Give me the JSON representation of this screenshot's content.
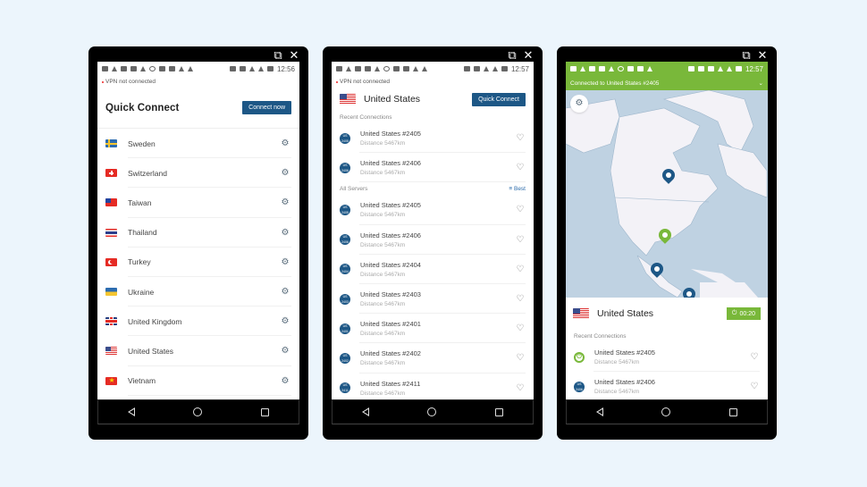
{
  "window_controls": {
    "popout_icon": "popout-icon",
    "close_icon": "close-icon"
  },
  "phone1": {
    "status_time": "12:56",
    "vpn_status": "VPN not connected",
    "title": "Quick Connect",
    "connect_button": "Connect now",
    "countries": [
      {
        "name": "Sweden",
        "flag": "se"
      },
      {
        "name": "Switzerland",
        "flag": "ch"
      },
      {
        "name": "Taiwan",
        "flag": "tw"
      },
      {
        "name": "Thailand",
        "flag": "th"
      },
      {
        "name": "Turkey",
        "flag": "tr"
      },
      {
        "name": "Ukraine",
        "flag": "ua"
      },
      {
        "name": "United Kingdom",
        "flag": "gb"
      },
      {
        "name": "United States",
        "flag": "us"
      },
      {
        "name": "Vietnam",
        "flag": "vn"
      }
    ]
  },
  "phone2": {
    "status_time": "12:57",
    "vpn_status": "VPN not connected",
    "title": "United States",
    "quick_connect_button": "Quick Connect",
    "recent_label": "Recent Connections",
    "recent": [
      {
        "name": "United States #2405",
        "distance": "Distance 5467km",
        "badge": "US 2405"
      },
      {
        "name": "United States #2406",
        "distance": "Distance 5467km",
        "badge": "US 2406"
      }
    ],
    "all_label": "All Servers",
    "sort_label": "Best",
    "servers": [
      {
        "name": "United States #2405",
        "distance": "Distance 5467km",
        "badge": "US 2405"
      },
      {
        "name": "United States #2406",
        "distance": "Distance 5467km",
        "badge": "US 2406"
      },
      {
        "name": "United States #2404",
        "distance": "Distance 5467km",
        "badge": "US 2404"
      },
      {
        "name": "United States #2403",
        "distance": "Distance 5467km",
        "badge": "US 2403"
      },
      {
        "name": "United States #2401",
        "distance": "Distance 5467km",
        "badge": "US 2401"
      },
      {
        "name": "United States #2402",
        "distance": "Distance 5467km",
        "badge": "US 2402"
      },
      {
        "name": "United States #2411",
        "distance": "Distance 5467km",
        "badge": "US 2411"
      }
    ]
  },
  "phone3": {
    "status_time": "12:57",
    "connected_text": "Connected to United States #2405",
    "country": "United States",
    "timer": "00:20",
    "recent_label": "Recent Connections",
    "recent": [
      {
        "name": "United States #2405",
        "distance": "Distance 5467km",
        "active": true
      },
      {
        "name": "United States #2406",
        "distance": "Distance 5467km",
        "badge": "US 2406",
        "active": false
      }
    ]
  },
  "colors": {
    "brand_blue": "#1d5786",
    "connected_green": "#79b83a",
    "background": "#ecf5fc"
  }
}
